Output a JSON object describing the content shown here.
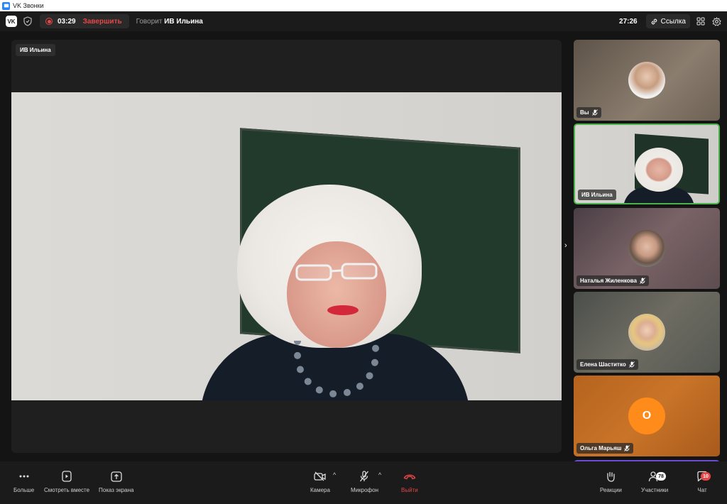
{
  "window": {
    "title": "VK Звонки"
  },
  "topbar": {
    "recording_time": "03:29",
    "end_recording_label": "Завершить",
    "speaking_prefix": "Говорит",
    "speaking_name": "ИВ Ильина",
    "clock": "27:26",
    "link_label": "Ссылка"
  },
  "stage": {
    "speaker_name": "ИВ Ильина"
  },
  "participants": [
    {
      "name": "Вы",
      "muted": true
    },
    {
      "name": "ИВ Ильина",
      "muted": false,
      "active": true
    },
    {
      "name": "Наталья Жиленкова",
      "muted": true
    },
    {
      "name": "Елена Шаститко",
      "muted": true
    },
    {
      "name": "Ольга Марьяш",
      "muted": true,
      "avatar_letter": "О"
    }
  ],
  "bottombar": {
    "more_label": "Больше",
    "watch_together_label": "Смотреть вместе",
    "screen_share_label": "Показ экрана",
    "camera_label": "Камера",
    "microphone_label": "Микрофон",
    "leave_label": "Выйти",
    "reactions_label": "Реакции",
    "participants_label": "Участники",
    "participants_count": "78",
    "chat_label": "Чат",
    "chat_count": "10"
  },
  "colors": {
    "accent_red": "#e64646",
    "active_border": "#4bb34b",
    "avatar_orange": "#ff8c1a",
    "vk_blue": "#2787f5"
  }
}
